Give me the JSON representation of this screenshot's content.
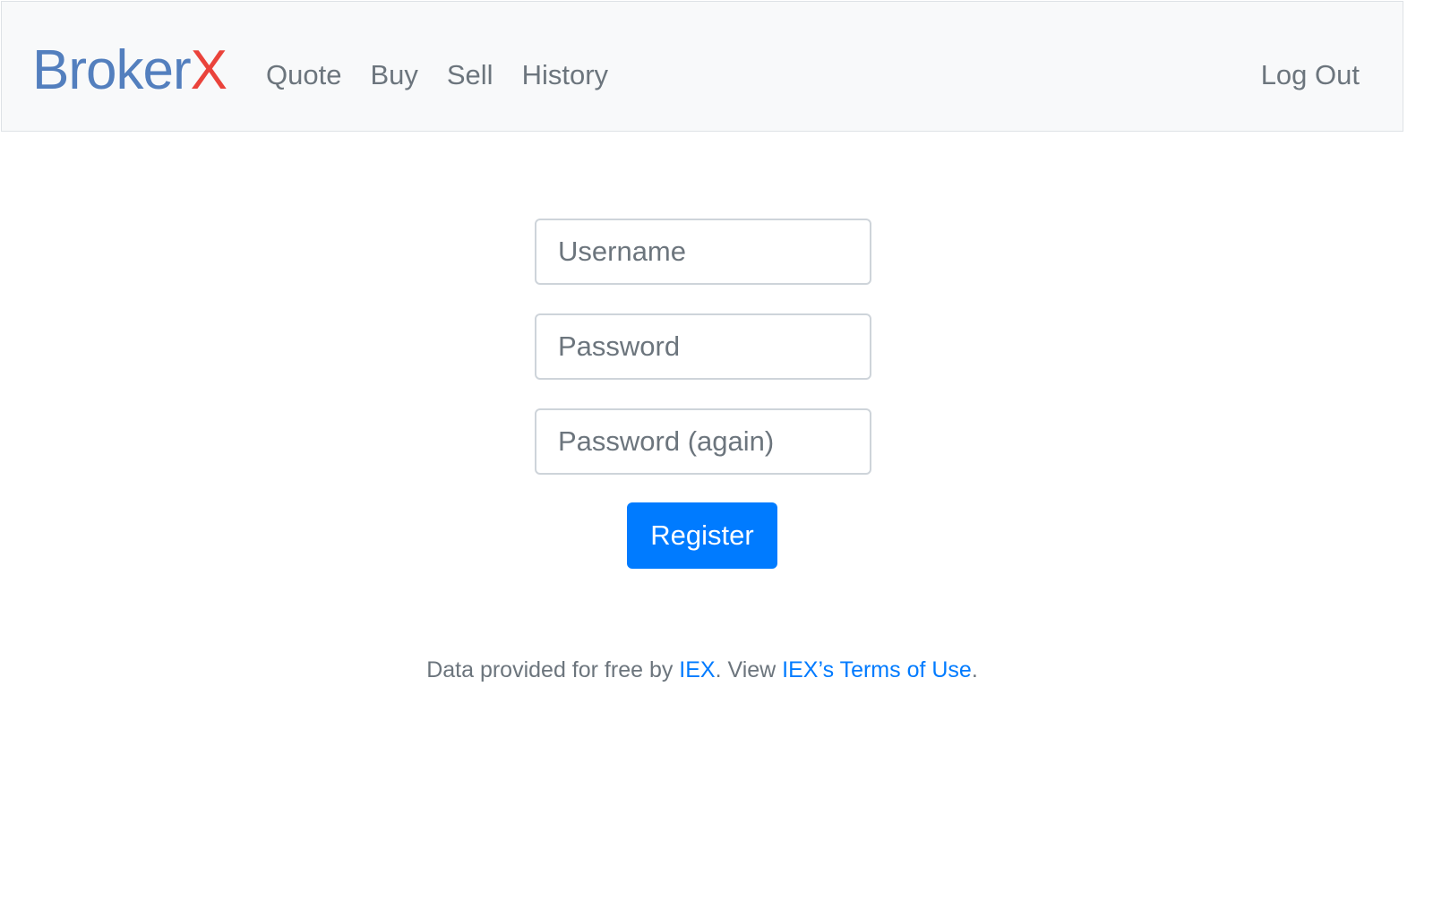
{
  "brand": {
    "part1": "Broker",
    "part2": "X"
  },
  "nav": {
    "items": [
      {
        "label": "Quote"
      },
      {
        "label": "Buy"
      },
      {
        "label": "Sell"
      },
      {
        "label": "History"
      }
    ],
    "logout_label": "Log Out"
  },
  "form": {
    "username_placeholder": "Username",
    "password_placeholder": "Password",
    "confirmation_placeholder": "Password (again)",
    "register_label": "Register"
  },
  "footer": {
    "text1": "Data provided for free by ",
    "link1": "IEX",
    "text2": ". View ",
    "link2": "IEX’s Terms of Use",
    "text3": "."
  },
  "colors": {
    "brand_primary": "#537fbe",
    "brand_accent": "#ea433b",
    "button": "#007bff",
    "link": "#007bff",
    "navbar_bg": "#f8f9fa"
  }
}
